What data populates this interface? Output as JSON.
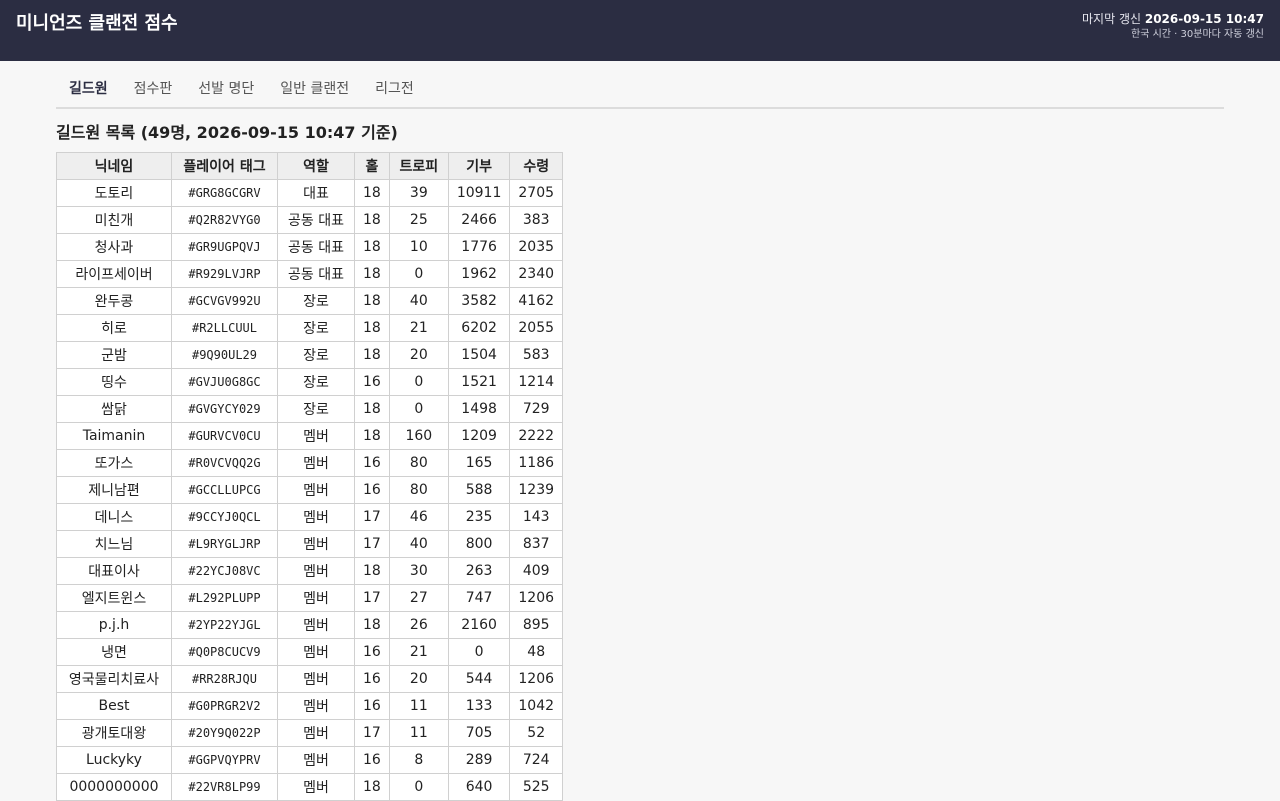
{
  "header": {
    "title": "미니언즈 클랜전 점수",
    "update_label": "마지막 갱신",
    "update_time": "2026-09-15 10:47",
    "update_note": "한국 시간 · 30분마다 자동 갱신"
  },
  "tabs": [
    {
      "label": "길드원",
      "active": true
    },
    {
      "label": "점수판",
      "active": false
    },
    {
      "label": "선발 명단",
      "active": false
    },
    {
      "label": "일반 클랜전",
      "active": false
    },
    {
      "label": "리그전",
      "active": false
    }
  ],
  "section": {
    "title": "길드원 목록 (49명, 2026-09-15 10:47 기준)"
  },
  "table": {
    "columns": [
      "닉네임",
      "플레이어 태그",
      "역할",
      "홀",
      "트로피",
      "기부",
      "수령"
    ],
    "rows": [
      [
        "도토리",
        "#GRG8GCGRV",
        "대표",
        "18",
        "39",
        "10911",
        "2705"
      ],
      [
        "미친개",
        "#Q2R82VYG0",
        "공동 대표",
        "18",
        "25",
        "2466",
        "383"
      ],
      [
        "청사과",
        "#GR9UGPQVJ",
        "공동 대표",
        "18",
        "10",
        "1776",
        "2035"
      ],
      [
        "라이프세이버",
        "#R929LVJRP",
        "공동 대표",
        "18",
        "0",
        "1962",
        "2340"
      ],
      [
        "완두콩",
        "#GCVGV992U",
        "장로",
        "18",
        "40",
        "3582",
        "4162"
      ],
      [
        "히로",
        "#R2LLCUUL",
        "장로",
        "18",
        "21",
        "6202",
        "2055"
      ],
      [
        "군밤",
        "#9Q90UL29",
        "장로",
        "18",
        "20",
        "1504",
        "583"
      ],
      [
        "띵수",
        "#GVJU0G8GC",
        "장로",
        "16",
        "0",
        "1521",
        "1214"
      ],
      [
        "쌈닭",
        "#GVGYCY029",
        "장로",
        "18",
        "0",
        "1498",
        "729"
      ],
      [
        "Taimanin",
        "#GURVCV0CU",
        "멤버",
        "18",
        "160",
        "1209",
        "2222"
      ],
      [
        "또가스",
        "#R0VCVQQ2G",
        "멤버",
        "16",
        "80",
        "165",
        "1186"
      ],
      [
        "제니남편",
        "#GCCLLUPCG",
        "멤버",
        "16",
        "80",
        "588",
        "1239"
      ],
      [
        "데니스",
        "#9CCYJ0QCL",
        "멤버",
        "17",
        "46",
        "235",
        "143"
      ],
      [
        "치느님",
        "#L9RYGLJRP",
        "멤버",
        "17",
        "40",
        "800",
        "837"
      ],
      [
        "대표이사",
        "#22YCJ08VC",
        "멤버",
        "18",
        "30",
        "263",
        "409"
      ],
      [
        "엘지트윈스",
        "#L292PLUPP",
        "멤버",
        "17",
        "27",
        "747",
        "1206"
      ],
      [
        "p.j.h",
        "#2YP22YJGL",
        "멤버",
        "18",
        "26",
        "2160",
        "895"
      ],
      [
        "냉면",
        "#Q0P8CUCV9",
        "멤버",
        "16",
        "21",
        "0",
        "48"
      ],
      [
        "영국물리치료사",
        "#RR28RJQU",
        "멤버",
        "16",
        "20",
        "544",
        "1206"
      ],
      [
        "Best",
        "#G0PRGR2V2",
        "멤버",
        "16",
        "11",
        "133",
        "1042"
      ],
      [
        "광개토대왕",
        "#20Y9Q022P",
        "멤버",
        "17",
        "11",
        "705",
        "52"
      ],
      [
        "Luckyky",
        "#GGPVQYPRV",
        "멤버",
        "16",
        "8",
        "289",
        "724"
      ],
      [
        "0000000000",
        "#22VR8LP99",
        "멤버",
        "18",
        "0",
        "640",
        "525"
      ]
    ]
  }
}
